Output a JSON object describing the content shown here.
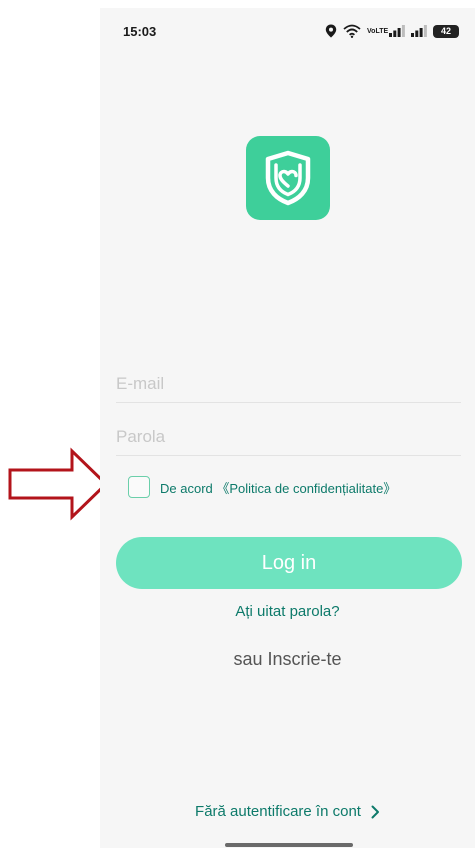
{
  "status_bar": {
    "time": "15:03",
    "volte_label_top": "Vo",
    "volte_label_bottom": "LTE",
    "battery_level": "42"
  },
  "app": {
    "logo_icon": "shield-heart-icon",
    "accent_color": "#3ecf9a"
  },
  "form": {
    "email_placeholder": "E-mail",
    "password_placeholder": "Parola",
    "agree_prefix": "De acord",
    "agree_policy": "《Politica de confidențialitate》",
    "login_label": "Log in",
    "forgot_label": "Ați uitat parola?",
    "signup_label": "sau Inscrie-te",
    "guest_label": "Fără autentificare în cont"
  },
  "annotation": {
    "arrow_color": "#b3141b"
  }
}
